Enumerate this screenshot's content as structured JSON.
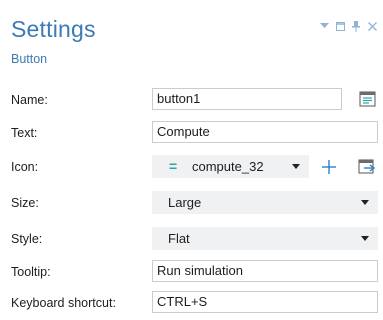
{
  "header": {
    "title": "Settings",
    "subtitle": "Button"
  },
  "window_controls": [
    "dropdown-arrow-icon",
    "restore-icon",
    "pin-icon",
    "close-icon"
  ],
  "form": {
    "name": {
      "label": "Name:",
      "value": "button1"
    },
    "text": {
      "label": "Text:",
      "value": "Compute"
    },
    "icon": {
      "label": "Icon:",
      "value": "compute_32"
    },
    "size": {
      "label": "Size:",
      "value": "Large"
    },
    "style": {
      "label": "Style:",
      "value": "Flat"
    },
    "tooltip": {
      "label": "Tooltip:",
      "value": "Run simulation"
    },
    "shortcut": {
      "label": "Keyboard shortcut:",
      "value": "CTRL+S"
    }
  },
  "colors": {
    "accent": "#3d7ab5",
    "icon_teal": "#2aa5a8",
    "dropdown_bg": "#f0f1f3",
    "field_border": "#c9cdd2"
  }
}
